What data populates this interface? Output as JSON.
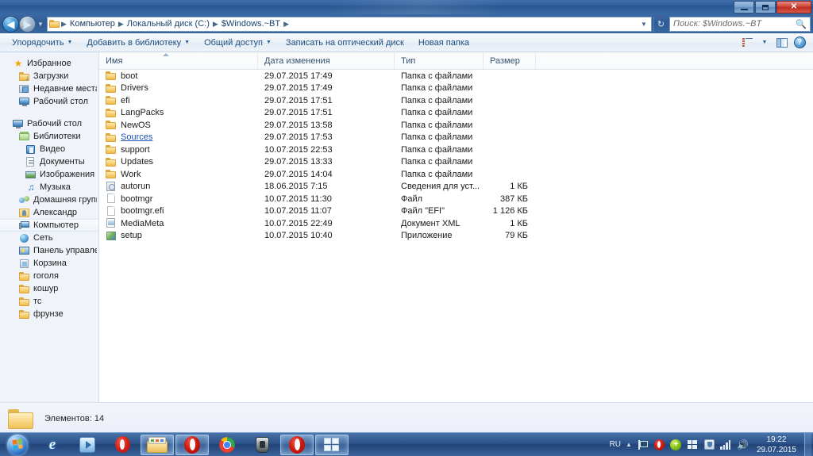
{
  "window": {
    "controls": {
      "minimize": "minimize-button",
      "maximize": "maximize-button",
      "close": "✕"
    }
  },
  "addressbar": {
    "back_glyph": "◀",
    "forward_glyph": "▶",
    "history_caret": "▼",
    "crumbs": [
      "Компьютер",
      "Локальный диск (C:)",
      "$Windows.~BT"
    ],
    "separator": "▶",
    "dropdown_caret": "▼",
    "refresh_glyph": "↻"
  },
  "search": {
    "placeholder": "Поиск: $Windows.~BT",
    "icon": "search-icon"
  },
  "toolbar": {
    "items": [
      {
        "label": "Упорядочить",
        "has_caret": true
      },
      {
        "label": "Добавить в библиотеку",
        "has_caret": true
      },
      {
        "label": "Общий доступ",
        "has_caret": true
      },
      {
        "label": "Записать на оптический диск",
        "has_caret": false
      },
      {
        "label": "Новая папка",
        "has_caret": false
      }
    ],
    "view_caret": "▼",
    "help_label": "?"
  },
  "sidebar": {
    "groups": [
      {
        "header": {
          "label": "Избранное",
          "icon": "star-icon",
          "indent": 0
        },
        "items": [
          {
            "label": "Загрузки",
            "icon": "downloads-icon",
            "indent": 1
          },
          {
            "label": "Недавние места",
            "icon": "recent-places-icon",
            "indent": 1
          },
          {
            "label": "Рабочий стол",
            "icon": "desktop-icon",
            "indent": 1
          }
        ]
      },
      {
        "header": {
          "label": "Рабочий стол",
          "icon": "desktop-icon",
          "indent": 0
        },
        "items": [
          {
            "label": "Библиотеки",
            "icon": "libraries-icon",
            "indent": 1
          },
          {
            "label": "Видео",
            "icon": "video-icon",
            "indent": 2
          },
          {
            "label": "Документы",
            "icon": "documents-icon",
            "indent": 2
          },
          {
            "label": "Изображения",
            "icon": "pictures-icon",
            "indent": 2
          },
          {
            "label": "Музыка",
            "icon": "music-icon",
            "indent": 2
          },
          {
            "label": "Домашняя группа",
            "icon": "homegroup-icon",
            "indent": 1
          },
          {
            "label": "Александр",
            "icon": "user-folder-icon",
            "indent": 1
          },
          {
            "label": "Компьютер",
            "icon": "computer-icon",
            "indent": 1,
            "selected": true
          },
          {
            "label": "Сеть",
            "icon": "network-icon",
            "indent": 1
          },
          {
            "label": "Панель управления",
            "icon": "control-panel-icon",
            "indent": 1
          },
          {
            "label": "Корзина",
            "icon": "recycle-bin-icon",
            "indent": 1
          },
          {
            "label": "гоголя",
            "icon": "folder-icon",
            "indent": 1
          },
          {
            "label": "кошур",
            "icon": "folder-icon",
            "indent": 1
          },
          {
            "label": "тс",
            "icon": "folder-icon",
            "indent": 1
          },
          {
            "label": "фрунзе",
            "icon": "folder-icon",
            "indent": 1
          }
        ]
      }
    ]
  },
  "filelist": {
    "columns": [
      "Имя",
      "Дата изменения",
      "Тип",
      "Размер"
    ],
    "sort_column": "Имя",
    "sort_direction": "ascending",
    "rows": [
      {
        "name": "boot",
        "modified": "29.07.2015 17:49",
        "type": "Папка с файлами",
        "size": "",
        "icon": "folder-icon"
      },
      {
        "name": "Drivers",
        "modified": "29.07.2015 17:49",
        "type": "Папка с файлами",
        "size": "",
        "icon": "folder-icon"
      },
      {
        "name": "efi",
        "modified": "29.07.2015 17:51",
        "type": "Папка с файлами",
        "size": "",
        "icon": "folder-icon"
      },
      {
        "name": "LangPacks",
        "modified": "29.07.2015 17:51",
        "type": "Папка с файлами",
        "size": "",
        "icon": "folder-icon"
      },
      {
        "name": "NewOS",
        "modified": "29.07.2015 13:58",
        "type": "Папка с файлами",
        "size": "",
        "icon": "folder-icon"
      },
      {
        "name": "Sources",
        "modified": "29.07.2015 17:53",
        "type": "Папка с файлами",
        "size": "",
        "icon": "folder-icon",
        "hovered": true
      },
      {
        "name": "support",
        "modified": "10.07.2015 22:53",
        "type": "Папка с файлами",
        "size": "",
        "icon": "folder-icon"
      },
      {
        "name": "Updates",
        "modified": "29.07.2015 13:33",
        "type": "Папка с файлами",
        "size": "",
        "icon": "folder-icon"
      },
      {
        "name": "Work",
        "modified": "29.07.2015 14:04",
        "type": "Папка с файлами",
        "size": "",
        "icon": "folder-icon"
      },
      {
        "name": "autorun",
        "modified": "18.06.2015 7:15",
        "type": "Сведения для уст...",
        "size": "1 КБ",
        "icon": "inf-file-icon"
      },
      {
        "name": "bootmgr",
        "modified": "10.07.2015 11:30",
        "type": "Файл",
        "size": "387 КБ",
        "icon": "blank-file-icon"
      },
      {
        "name": "bootmgr.efi",
        "modified": "10.07.2015 11:07",
        "type": "Файл \"EFI\"",
        "size": "1 126 КБ",
        "icon": "blank-file-icon"
      },
      {
        "name": "MediaMeta",
        "modified": "10.07.2015 22:49",
        "type": "Документ XML",
        "size": "1 КБ",
        "icon": "xml-file-icon"
      },
      {
        "name": "setup",
        "modified": "10.07.2015 10:40",
        "type": "Приложение",
        "size": "79 КБ",
        "icon": "application-icon"
      }
    ]
  },
  "statusbar": {
    "text": "Элементов: 14",
    "icon": "folder-large-icon"
  },
  "taskbar": {
    "start_button": "start-orb",
    "buttons": [
      {
        "name": "internet-explorer",
        "active": false
      },
      {
        "name": "windows-media-player",
        "active": false
      },
      {
        "name": "opera-browser",
        "active": false
      },
      {
        "name": "windows-explorer",
        "active": true
      },
      {
        "name": "opera-window",
        "active": true
      },
      {
        "name": "google-chrome",
        "active": false
      },
      {
        "name": "world-of-tanks",
        "active": false
      },
      {
        "name": "opera-window-2",
        "active": true
      },
      {
        "name": "get-windows-10",
        "active": true
      }
    ],
    "tray": {
      "language": "RU",
      "expand_caret": "▲",
      "icons": [
        "flag-action-center-icon",
        "opera-tray-icon",
        "update-tray-icon",
        "windows-tray-icon",
        "security-tray-icon",
        "network-signal-icon",
        "volume-icon"
      ],
      "time": "19:22",
      "date": "29.07.2015"
    }
  },
  "colors": {
    "accent": "#2f5f9e",
    "taskbar": "#2a5087",
    "folder": "#f8d27a",
    "link": "#1a4fb4"
  }
}
